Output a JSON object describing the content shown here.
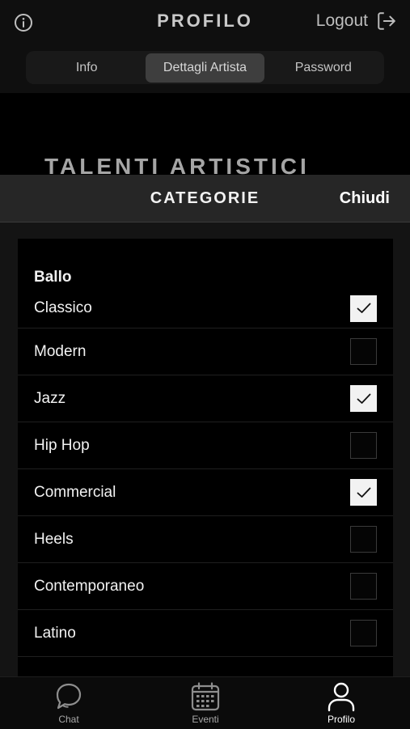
{
  "header": {
    "title": "PROFILO",
    "logout_label": "Logout",
    "tabs": [
      {
        "label": "Info"
      },
      {
        "label": "Dettagli Artista"
      },
      {
        "label": "Password"
      }
    ]
  },
  "background_heading": "TALENTI ARTISTICI",
  "sheet": {
    "title": "CATEGORIE",
    "close_label": "Chiudi",
    "group": "Ballo",
    "items": [
      {
        "label": "Classico",
        "checked": true
      },
      {
        "label": "Modern",
        "checked": false
      },
      {
        "label": "Jazz",
        "checked": true
      },
      {
        "label": "Hip Hop",
        "checked": false
      },
      {
        "label": "Commercial",
        "checked": true
      },
      {
        "label": "Heels",
        "checked": false
      },
      {
        "label": "Contemporaneo",
        "checked": false
      },
      {
        "label": "Latino",
        "checked": false
      }
    ]
  },
  "nav": {
    "items": [
      {
        "label": "Chat",
        "icon": "chat-bubble-icon"
      },
      {
        "label": "Eventi",
        "icon": "calendar-icon"
      },
      {
        "label": "Profilo",
        "icon": "user-icon",
        "active": true
      }
    ]
  }
}
